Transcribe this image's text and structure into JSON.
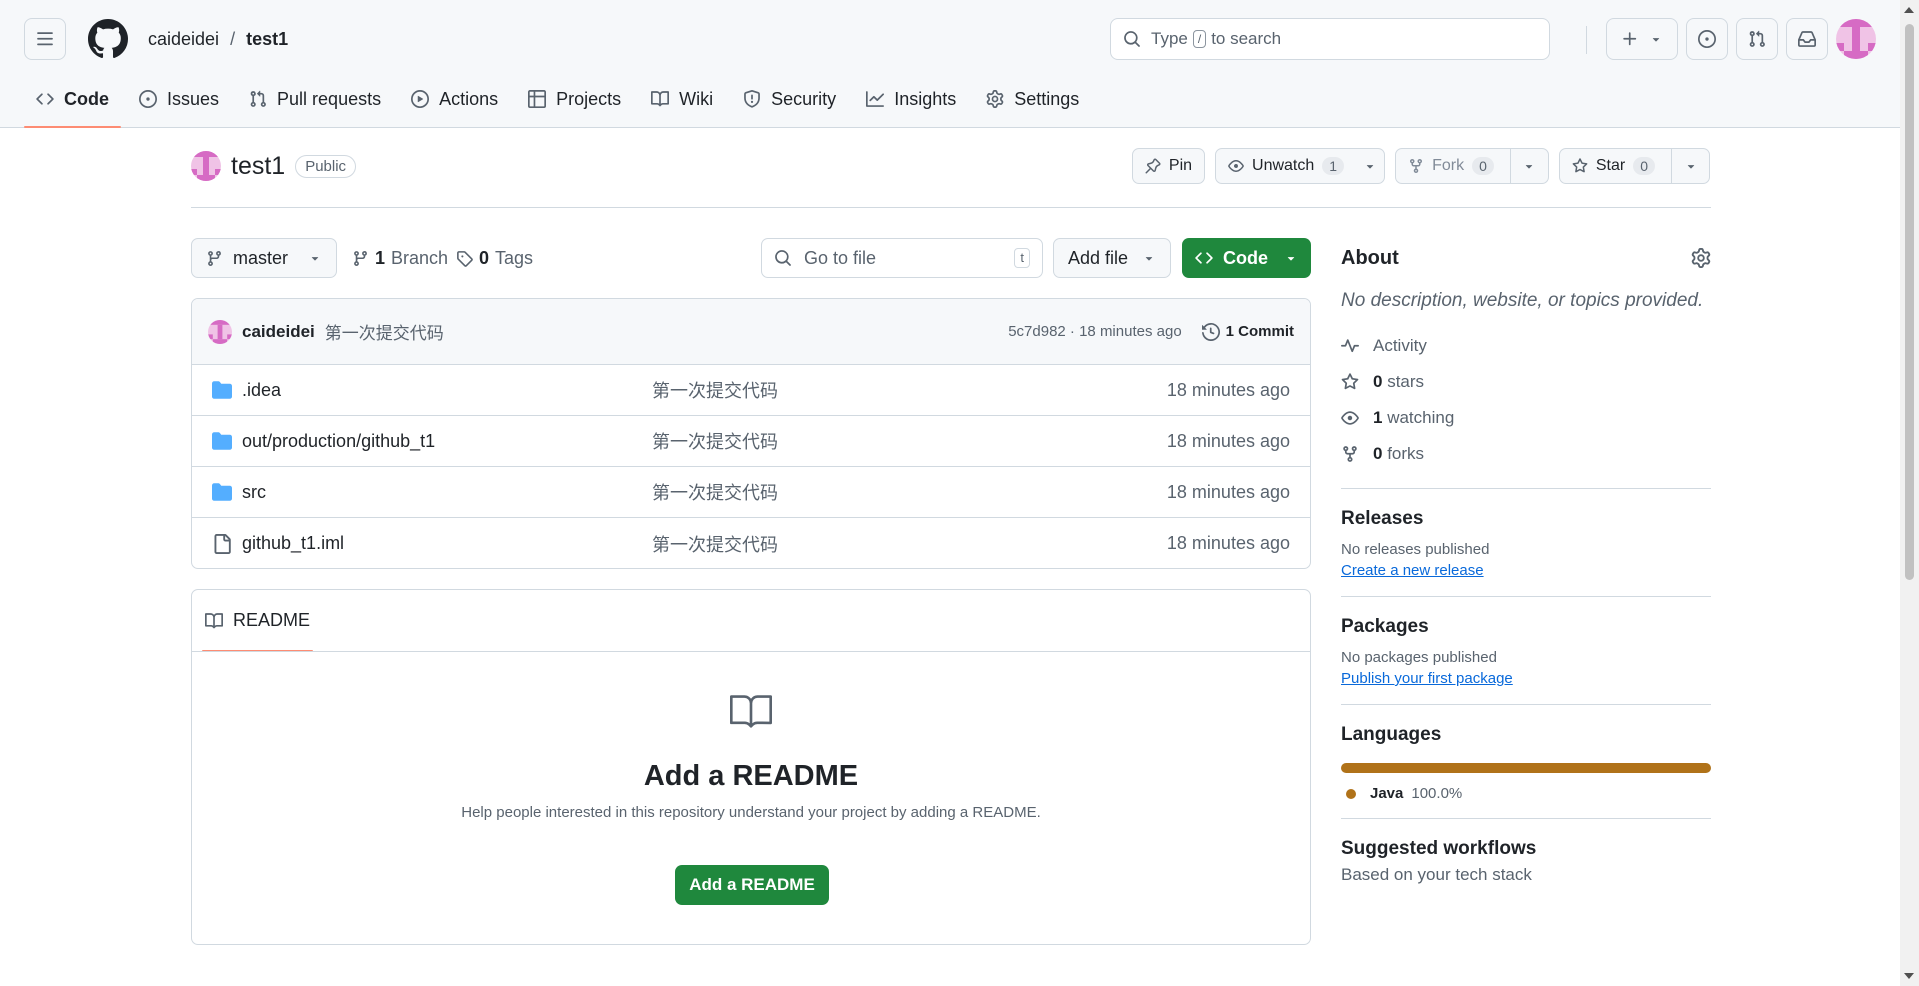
{
  "header": {
    "owner": "caideidei",
    "separator": "/",
    "repo": "test1",
    "search_prefix": "Type",
    "search_key": "/",
    "search_suffix": "to search"
  },
  "nav": {
    "tabs": [
      {
        "label": "Code",
        "icon": "code-icon",
        "active": true
      },
      {
        "label": "Issues",
        "icon": "issue-icon"
      },
      {
        "label": "Pull requests",
        "icon": "pull-request-icon"
      },
      {
        "label": "Actions",
        "icon": "play-icon"
      },
      {
        "label": "Projects",
        "icon": "table-icon"
      },
      {
        "label": "Wiki",
        "icon": "book-icon"
      },
      {
        "label": "Security",
        "icon": "shield-icon"
      },
      {
        "label": "Insights",
        "icon": "graph-icon"
      },
      {
        "label": "Settings",
        "icon": "gear-icon"
      }
    ]
  },
  "repo": {
    "name": "test1",
    "visibility": "Public",
    "pin_label": "Pin",
    "watch_label": "Unwatch",
    "watch_count": "1",
    "fork_label": "Fork",
    "fork_count": "0",
    "star_label": "Star",
    "star_count": "0"
  },
  "filenav": {
    "branch": "master",
    "branch_count": "1",
    "branch_label": "Branch",
    "tag_count": "0",
    "tag_label": "Tags",
    "goto_placeholder": "Go to file",
    "goto_key": "t",
    "add_file_label": "Add file",
    "code_label": "Code"
  },
  "commit": {
    "author": "caideidei",
    "message": "第一次提交代码",
    "sha_time": "5c7d982 · 18 minutes ago",
    "commits_label": "1 Commit"
  },
  "files": [
    {
      "name": ".idea",
      "type": "folder",
      "message": "第一次提交代码",
      "date": "18 minutes ago"
    },
    {
      "name": "out/production/github_t1",
      "type": "folder",
      "message": "第一次提交代码",
      "date": "18 minutes ago"
    },
    {
      "name": "src",
      "type": "folder",
      "message": "第一次提交代码",
      "date": "18 minutes ago"
    },
    {
      "name": "github_t1.iml",
      "type": "file",
      "message": "第一次提交代码",
      "date": "18 minutes ago"
    }
  ],
  "readme": {
    "tab_label": "README",
    "title": "Add a README",
    "description": "Help people interested in this repository understand your project by adding a README.",
    "button": "Add a README"
  },
  "about": {
    "heading": "About",
    "description": "No description, website, or topics provided.",
    "activity": "Activity",
    "stars_count": "0",
    "stars_label": "stars",
    "watching_count": "1",
    "watching_label": "watching",
    "forks_count": "0",
    "forks_label": "forks"
  },
  "releases": {
    "heading": "Releases",
    "empty": "No releases published",
    "link": "Create a new release"
  },
  "packages": {
    "heading": "Packages",
    "empty": "No packages published",
    "link": "Publish your first package"
  },
  "languages": {
    "heading": "Languages",
    "items": [
      {
        "name": "Java",
        "percent": "100.0%",
        "fraction": 1.0,
        "color": "#b07219"
      }
    ]
  },
  "workflows": {
    "heading": "Suggested workflows",
    "subtitle": "Based on your tech stack"
  },
  "colors": {
    "accent_green": "#1f883d",
    "tab_underline": "#fd8c73",
    "link_blue": "#0969da",
    "folder_blue": "#54aeff"
  }
}
